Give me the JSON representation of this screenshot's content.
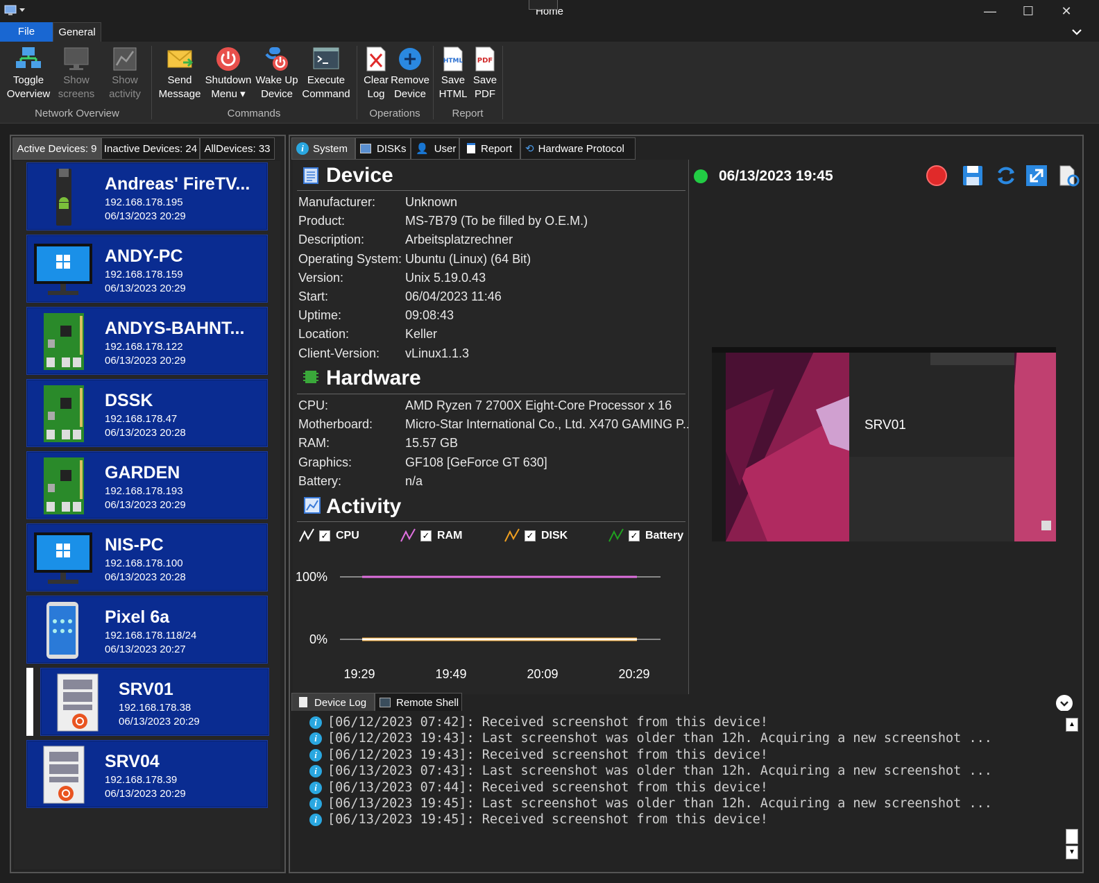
{
  "window": {
    "title": "Home",
    "minimize": "—",
    "maximize": "☐",
    "close": "✕"
  },
  "menu_tabs": {
    "file": "File",
    "general": "General"
  },
  "ribbon": {
    "groups": {
      "network": "Network Overview",
      "commands": "Commands",
      "operations": "Operations",
      "report": "Report"
    },
    "buttons": {
      "toggle_overview": [
        "Toggle",
        "Overview"
      ],
      "show_screens": [
        "Show",
        "screens"
      ],
      "show_activity": [
        "Show",
        "activity"
      ],
      "send_message": [
        "Send",
        "Message"
      ],
      "shutdown_menu": [
        "Shutdown",
        "Menu ▾"
      ],
      "wake_up": [
        "Wake Up",
        "Device"
      ],
      "execute": [
        "Execute",
        "Command"
      ],
      "clear_log": [
        "Clear",
        "Log"
      ],
      "remove_device": [
        "Remove",
        "Device"
      ],
      "save_html": [
        "Save",
        "HTML"
      ],
      "save_pdf": [
        "Save",
        "PDF"
      ]
    }
  },
  "device_tabs": {
    "active": "Active Devices: 9",
    "inactive": "Inactive Devices: 24",
    "all": "AllDevices: 33"
  },
  "devices": [
    {
      "name": "Andreas' FireTV...",
      "ip": "192.168.178.195",
      "date": "06/13/2023 20:29",
      "icon": "firetv-icon"
    },
    {
      "name": "ANDY-PC",
      "ip": "192.168.178.159",
      "date": "06/13/2023 20:29",
      "icon": "windows-monitor-icon"
    },
    {
      "name": "ANDYS-BAHNT...",
      "ip": "192.168.178.122",
      "date": "06/13/2023 20:29",
      "icon": "raspberry-pi-icon"
    },
    {
      "name": "DSSK",
      "ip": "192.168.178.47",
      "date": "06/13/2023 20:28",
      "icon": "raspberry-pi-icon"
    },
    {
      "name": "GARDEN",
      "ip": "192.168.178.193",
      "date": "06/13/2023 20:29",
      "icon": "raspberry-pi-icon"
    },
    {
      "name": "NIS-PC",
      "ip": "192.168.178.100",
      "date": "06/13/2023 20:28",
      "icon": "windows-monitor-icon"
    },
    {
      "name": "Pixel 6a",
      "ip": "192.168.178.118/24",
      "date": "06/13/2023 20:27",
      "icon": "phone-icon"
    },
    {
      "name": "SRV01",
      "ip": "192.168.178.38",
      "date": "06/13/2023 20:29",
      "icon": "ubuntu-server-icon"
    },
    {
      "name": "SRV04",
      "ip": "192.168.178.39",
      "date": "06/13/2023 20:29",
      "icon": "ubuntu-server-icon"
    }
  ],
  "detail_tabs": {
    "system": "System",
    "disks": "DISKs",
    "user": "User",
    "report": "Report",
    "hardware": "Hardware Protocol"
  },
  "device_section": {
    "title": "Device",
    "rows": [
      {
        "label": "Manufacturer:",
        "value": "Unknown"
      },
      {
        "label": "Product:",
        "value": "MS-7B79 (To be filled by O.E.M.)"
      },
      {
        "label": "Description:",
        "value": "Arbeitsplatzrechner"
      },
      {
        "label": "Operating System:",
        "value": "Ubuntu (Linux) (64 Bit)"
      },
      {
        "label": "Version:",
        "value": "Unix 5.19.0.43"
      },
      {
        "label": "Start:",
        "value": "06/04/2023 11:46"
      },
      {
        "label": "Uptime:",
        "value": "09:08:43"
      },
      {
        "label": "Location:",
        "value": "Keller"
      },
      {
        "label": "Client-Version:",
        "value": "vLinux1.1.3"
      }
    ]
  },
  "hardware_section": {
    "title": "Hardware",
    "rows": [
      {
        "label": "CPU:",
        "value": "AMD Ryzen 7 2700X Eight-Core Processor  x 16"
      },
      {
        "label": "Motherboard:",
        "value": "Micro-Star International Co., Ltd. X470 GAMING P..."
      },
      {
        "label": "RAM:",
        "value": "15.57 GB"
      },
      {
        "label": "Graphics:",
        "value": "GF108 [GeForce GT 630]"
      },
      {
        "label": "Battery:",
        "value": "n/a"
      }
    ]
  },
  "activity_section": {
    "title": "Activity"
  },
  "chart_data": {
    "type": "line",
    "x": [
      "19:29",
      "19:49",
      "20:09",
      "20:29"
    ],
    "ylim": [
      0,
      100
    ],
    "yticks": [
      "100%",
      "0%"
    ],
    "series": [
      {
        "name": "CPU",
        "color": "#ffffff",
        "values": [
          0,
          0,
          0,
          0
        ]
      },
      {
        "name": "RAM",
        "color": "#e070e0",
        "values": [
          100,
          100,
          100,
          100
        ]
      },
      {
        "name": "DISK",
        "color": "#f0a020",
        "values": [
          0,
          0,
          0,
          0
        ]
      },
      {
        "name": "Battery",
        "color": "#20a020",
        "values": [
          0,
          0,
          0,
          0
        ]
      }
    ]
  },
  "screenshot_panel": {
    "timestamp": "06/13/2023 19:45",
    "status_color": "#22cc44",
    "screen_label": "SRV01"
  },
  "bottom_tabs": {
    "device_log": "Device Log",
    "remote_shell": "Remote Shell"
  },
  "log": [
    "[06/12/2023 07:42]: Received screenshot from this device!",
    "[06/12/2023 19:43]: Last screenshot was older than 12h. Acquiring a new screenshot ...",
    "[06/12/2023 19:43]: Received screenshot from this device!",
    "[06/13/2023 07:43]: Last screenshot was older than 12h. Acquiring a new screenshot ...",
    "[06/13/2023 07:44]: Received screenshot from this device!",
    "[06/13/2023 19:45]: Last screenshot was older than 12h. Acquiring a new screenshot ...",
    "[06/13/2023 19:45]: Received screenshot from this device!"
  ]
}
